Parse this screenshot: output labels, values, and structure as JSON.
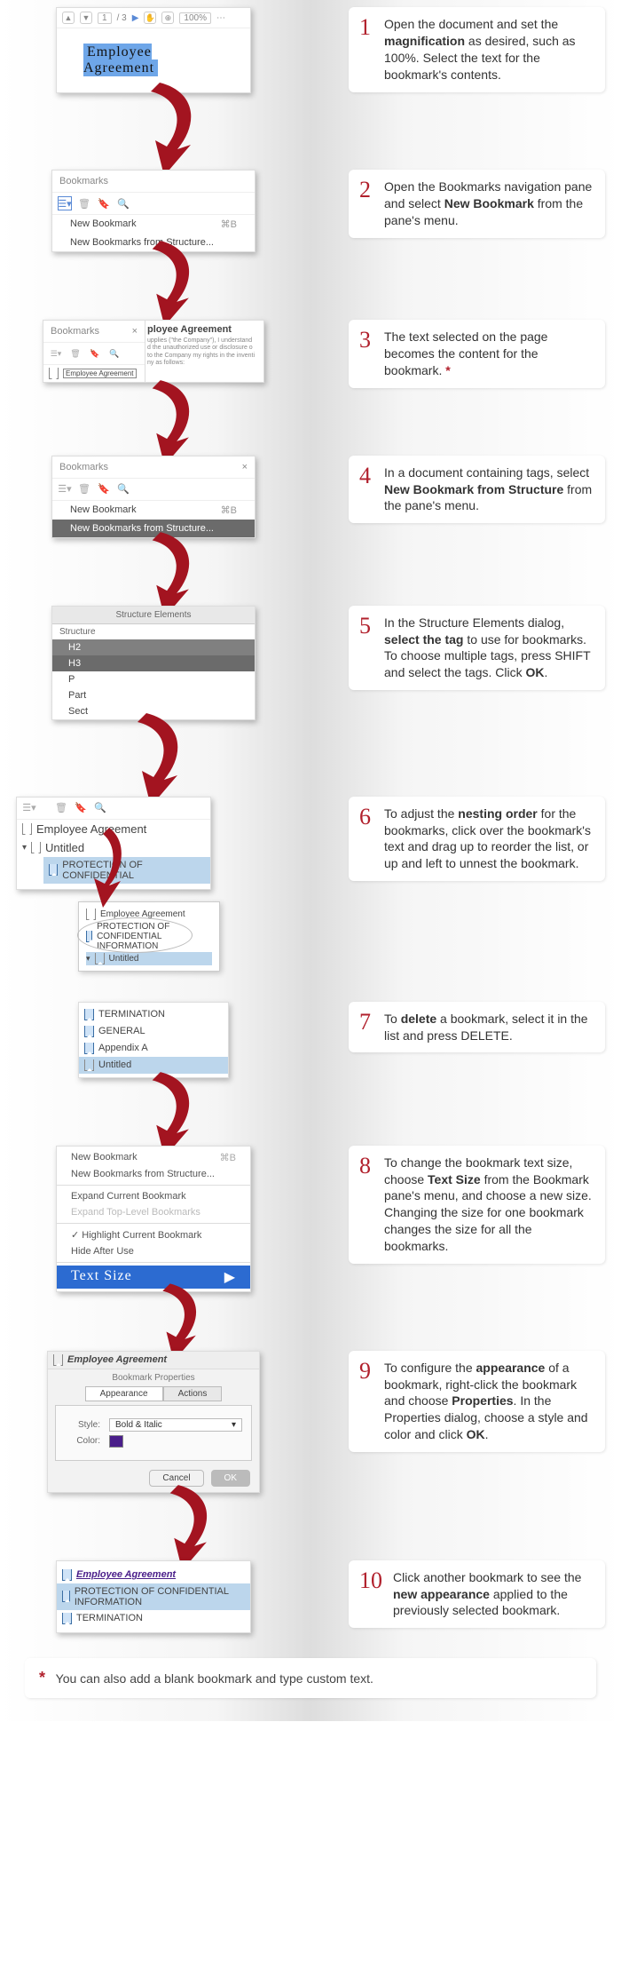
{
  "steps": [
    {
      "n": "1",
      "html": "Open the document and set the <b>magnification</b> as desired, such as 100%. Select the text for the bookmark's contents."
    },
    {
      "n": "2",
      "html": "Open the Bookmarks navigation pane and select <b>New Bookmark</b> from the pane's menu."
    },
    {
      "n": "3",
      "html": "The text selected on the page becomes the content for the bookmark. <span class='star'>*</span>"
    },
    {
      "n": "4",
      "html": "In a document containing tags, select <b>New Bookmark from Structure</b> from the pane's menu."
    },
    {
      "n": "5",
      "html": "In the Structure Elements dialog, <b>select the tag</b> to use for bookmarks. To choose multiple tags, press SHIFT and select the tags. Click <b>OK</b>."
    },
    {
      "n": "6",
      "html": "To adjust the <b>nesting order</b> for the bookmarks, click over the bookmark's text and drag up to reorder the list, or up and left to unnest the bookmark."
    },
    {
      "n": "7",
      "html": "To <b>delete</b> a bookmark, select it in the list and press DELETE."
    },
    {
      "n": "8",
      "html": "To change the bookmark text size, choose <b>Text Size</b> from the Bookmark pane's menu, and choose a new size. Changing the size for one bookmark changes the size for all the bookmarks."
    },
    {
      "n": "9",
      "html": "To configure the <b>appearance</b> of a bookmark, right-click the bookmark and choose <b>Properties</b>. In the Properties dialog, choose a style and color and click <b>OK</b>."
    },
    {
      "n": "10",
      "html": "Click another bookmark to see the <b>new appearance</b> applied to the previously selected bookmark."
    }
  ],
  "s1": {
    "page": "1",
    "pages": "/ 3",
    "zoom": "100%",
    "selected": "Employee  Agreement"
  },
  "s2": {
    "title": "Bookmarks",
    "menu1": "New Bookmark",
    "menu1_k": "⌘B",
    "menu2": "New Bookmarks from Structure..."
  },
  "s3": {
    "title": "Bookmarks",
    "entry": "Employee Agreement",
    "doc_title": "ployee Agreement",
    "l1": "upplies (\"the Company\"), I understand",
    "l2": "d the unauthorized  use or disclosure o",
    "l3": "to the Company my rights in the inventi",
    "l4": "ny as follows:"
  },
  "s4": {
    "title": "Bookmarks",
    "menu1": "New Bookmark",
    "menu1_k": "⌘B",
    "menu2": "New Bookmarks from Structure..."
  },
  "s5": {
    "head": "Structure Elements",
    "label": "Structure",
    "rows": [
      "H2",
      "H3",
      "P",
      "Part",
      "Sect"
    ]
  },
  "s6": {
    "top_entry": "Employee Agreement",
    "untitled": "Untitled",
    "prot": "PROTECTION OF CONFIDENTIAL",
    "tip1": "Employee Agreement",
    "tip2": "PROTECTION OF CONFIDENTIAL INFORMATION",
    "tip3": "Untitled"
  },
  "s7": {
    "r1": "TERMINATION",
    "r2": "GENERAL",
    "r3": "Appendix A",
    "r4": "Untitled"
  },
  "s8": {
    "m1": "New Bookmark",
    "m1k": "⌘B",
    "m2": "New Bookmarks from Structure...",
    "m3": "Expand Current Bookmark",
    "m4": "Expand Top-Level Bookmarks",
    "m5": "Highlight Current Bookmark",
    "m6": "Hide After Use",
    "m7": "Text Size"
  },
  "s9": {
    "bk": "Employee Agreement",
    "header": "Bookmark Properties",
    "tab1": "Appearance",
    "tab2": "Actions",
    "style_l": "Style:",
    "style_v": "Bold & Italic",
    "color_l": "Color:",
    "cancel": "Cancel",
    "ok": "OK"
  },
  "s10": {
    "r1": "Employee Agreement",
    "r2": "PROTECTION OF CONFIDENTIAL INFORMATION",
    "r3": "TERMINATION"
  },
  "footnote": "You can also add a blank bookmark and type custom text."
}
